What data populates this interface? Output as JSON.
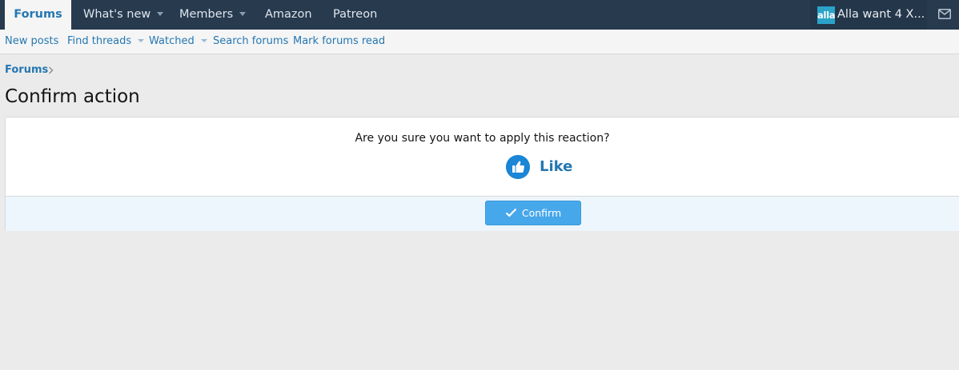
{
  "topnav": {
    "tabs": [
      {
        "label": "Forums",
        "active": true
      },
      {
        "label": "What's new",
        "dropdown": true
      },
      {
        "label": "Members",
        "dropdown": true
      },
      {
        "label": "Amazon"
      },
      {
        "label": "Patreon"
      }
    ],
    "account": {
      "avatar_text": "alla",
      "name": "Alla want 4 X..."
    }
  },
  "subnav": {
    "items": [
      {
        "label": "New posts"
      },
      {
        "label": "Find threads",
        "dropdown": true
      },
      {
        "label": "Watched",
        "dropdown": true
      },
      {
        "label": "Search forums"
      },
      {
        "label": "Mark forums read"
      }
    ]
  },
  "breadcrumb": {
    "items": [
      "Forums"
    ]
  },
  "page": {
    "title": "Confirm action"
  },
  "dialog": {
    "question": "Are you sure you want to apply this reaction?",
    "reaction": {
      "label": "Like",
      "icon": "thumbs-up-icon"
    },
    "confirm_label": "Confirm"
  },
  "colors": {
    "nav_bg": "#273a4e",
    "link": "#2577b1",
    "button": "#47a7eb",
    "footer_bg": "#edf6fd"
  }
}
